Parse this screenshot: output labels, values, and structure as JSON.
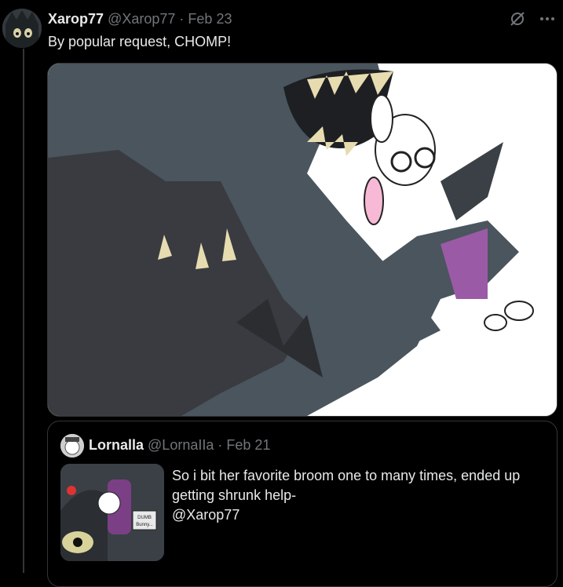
{
  "tweet": {
    "display_name": "Xarop77",
    "handle": "@Xarop77",
    "separator": "·",
    "date": "Feb 23",
    "text": "By popular request, CHOMP!"
  },
  "actions": {
    "grok_icon": "slashed-circle-icon",
    "more_icon": "more-icon"
  },
  "quote": {
    "display_name": "Lornalla",
    "handle": "@LornaIIa",
    "separator": "·",
    "date": "Feb 21",
    "text_lines": [
      "So i bit her favorite broom one to many times, ended up",
      "getting shrunk help-",
      "@Xarop77"
    ],
    "thumb_sign": "DUMB Bunny..."
  },
  "colors": {
    "background": "#000000",
    "muted": "#71767b",
    "text": "#e7e9ea",
    "border": "#333639"
  }
}
